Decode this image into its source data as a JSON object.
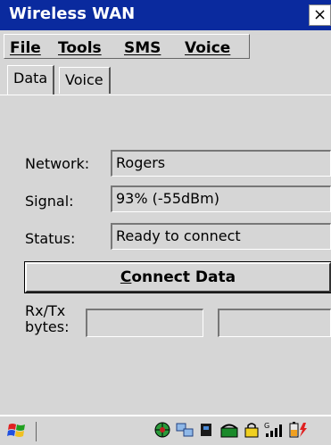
{
  "window": {
    "title": "Wireless WAN",
    "close_symbol": "×"
  },
  "menu": {
    "items": [
      {
        "label": "File"
      },
      {
        "label": "Tools"
      },
      {
        "label": "SMS"
      },
      {
        "label": "Voice"
      }
    ]
  },
  "tabs": [
    {
      "label": "Data",
      "active": true
    },
    {
      "label": "Voice",
      "active": false
    }
  ],
  "form": {
    "network_label": "Network:",
    "network_value": "Rogers",
    "signal_label": "Signal:",
    "signal_value": "93% (-55dBm)",
    "status_label": "Status:",
    "status_value": "Ready to connect",
    "connect_button_prefix": "C",
    "connect_button_rest": "onnect Data",
    "rxtx_label_line1": "Rx/Tx",
    "rxtx_label_line2": "bytes:",
    "rx_value": "",
    "tx_value": ""
  },
  "taskbar": {
    "icons": [
      "start-windows-icon",
      "globe-icon",
      "network-icon",
      "card-icon",
      "phone-icon",
      "battery-lock-icon",
      "signal-bars-icon",
      "battery-charging-icon"
    ]
  },
  "colors": {
    "titlebar": "#0a2a9e",
    "background": "#d6d6d6"
  }
}
